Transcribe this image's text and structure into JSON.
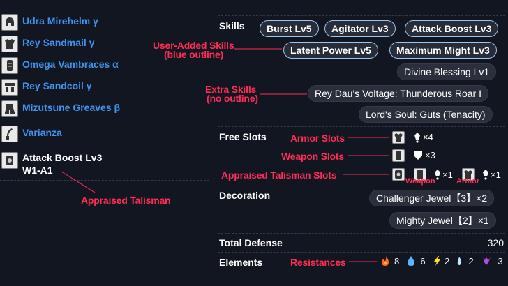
{
  "equipment": [
    {
      "name": "Udra Mirehelm γ",
      "icon": "helm-icon"
    },
    {
      "name": "Rey Sandmail γ",
      "icon": "chest-icon"
    },
    {
      "name": "Omega Vambraces α",
      "icon": "arms-icon"
    },
    {
      "name": "Rey Sandcoil γ",
      "icon": "waist-icon"
    },
    {
      "name": "Mizutsune Greaves β",
      "icon": "legs-icon"
    }
  ],
  "weapon": {
    "name": "Varianza",
    "icon": "sword-icon"
  },
  "talisman": {
    "line1": "Attack Boost Lv3",
    "line2": "W1-A1",
    "icon": "talisman-icon"
  },
  "labels": {
    "skills": "Skills",
    "free_slots": "Free Slots",
    "decoration": "Decoration",
    "total_defense": "Total Defense",
    "elements": "Elements"
  },
  "skills": {
    "row1": [
      "Burst Lv5",
      "Agitator Lv3",
      "Attack Boost Lv3"
    ],
    "user_added": [
      "Latent Power Lv5",
      "Maximum Might Lv3"
    ],
    "extra": [
      "Divine Blessing Lv1",
      "Rey Dau's Voltage: Thunderous Roar I",
      "Lord's Soul: Guts (Tenacity)"
    ]
  },
  "free_slots": {
    "armor": "×4",
    "weapon": "×3",
    "talisman_weapon": "×1",
    "talisman_armor": "×1"
  },
  "decorations": [
    "Challenger Jewel【3】×2",
    "Mighty Jewel【2】×1"
  ],
  "total_defense": "320",
  "resistances": {
    "fire": "8",
    "water": "-6",
    "thunder": "2",
    "ice": "-2",
    "dragon": "-3"
  },
  "annotations": {
    "user_added_1": "User-Added Skills",
    "user_added_2": "(blue outline)",
    "extra_1": "Extra Skills",
    "extra_2": "(no outline)",
    "armor_slots": "Armor Slots",
    "weapon_slots": "Weapon Slots",
    "appraised_slots": "Appraised Talisman Slots",
    "weapon_small": "Weapon",
    "armor_small": "Armor",
    "appraised_talisman": "Appraised Talisman",
    "resistances": "Resistances"
  },
  "colors": {
    "background": "#121620",
    "equipment_name": "#3e93ee",
    "annotation": "#ff2d55",
    "user_added_outline": "#9cc6f2",
    "fire": "#ff6a1a",
    "water": "#5ab4ff",
    "thunder": "#ffe21a",
    "ice": "#bfe7ff",
    "dragon": "#b04be8"
  }
}
